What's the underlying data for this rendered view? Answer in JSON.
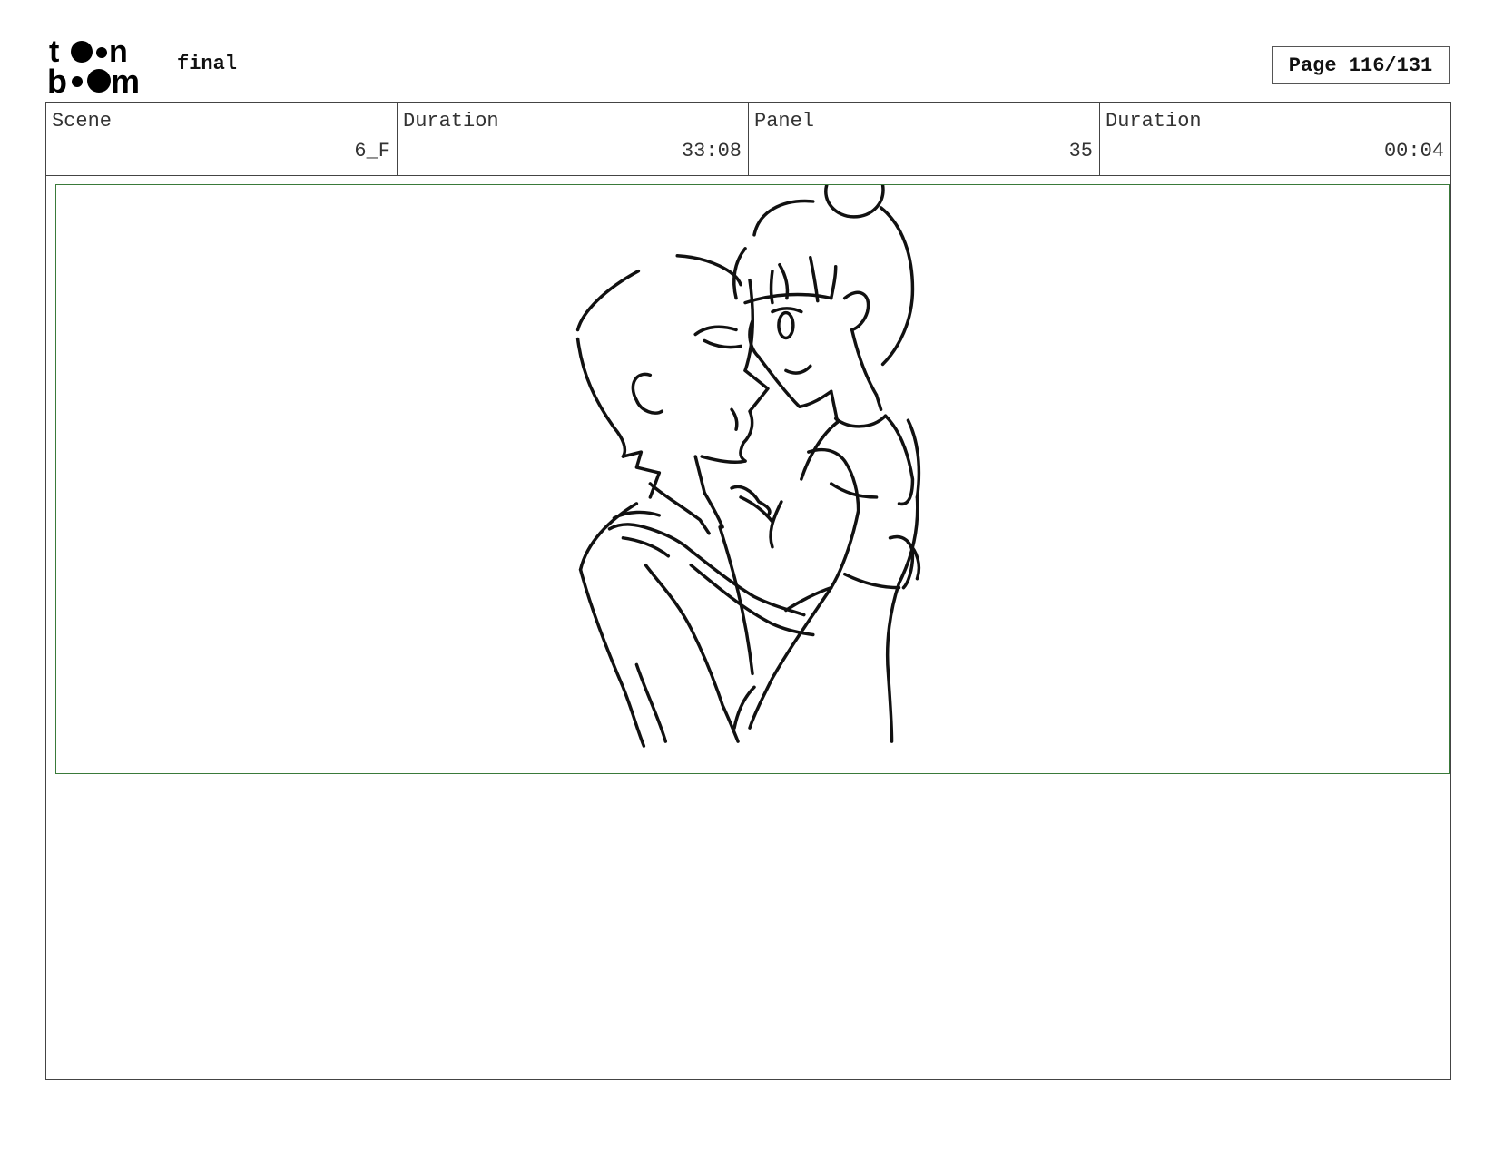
{
  "header": {
    "logo_icon": "toon-boom-logo",
    "project_title": "final",
    "page_label": "Page 116/131"
  },
  "info": {
    "scene_label": "Scene",
    "scene_value": "6_F",
    "scene_duration_label": "Duration",
    "scene_duration_value": "33:08",
    "panel_label": "Panel",
    "panel_value": "35",
    "panel_duration_label": "Duration",
    "panel_duration_value": "00:04"
  },
  "panel": {
    "image_icon": "sketch-couple-embrace",
    "safe_area_color": "#3a7a3a"
  },
  "notes": {
    "text": ""
  }
}
